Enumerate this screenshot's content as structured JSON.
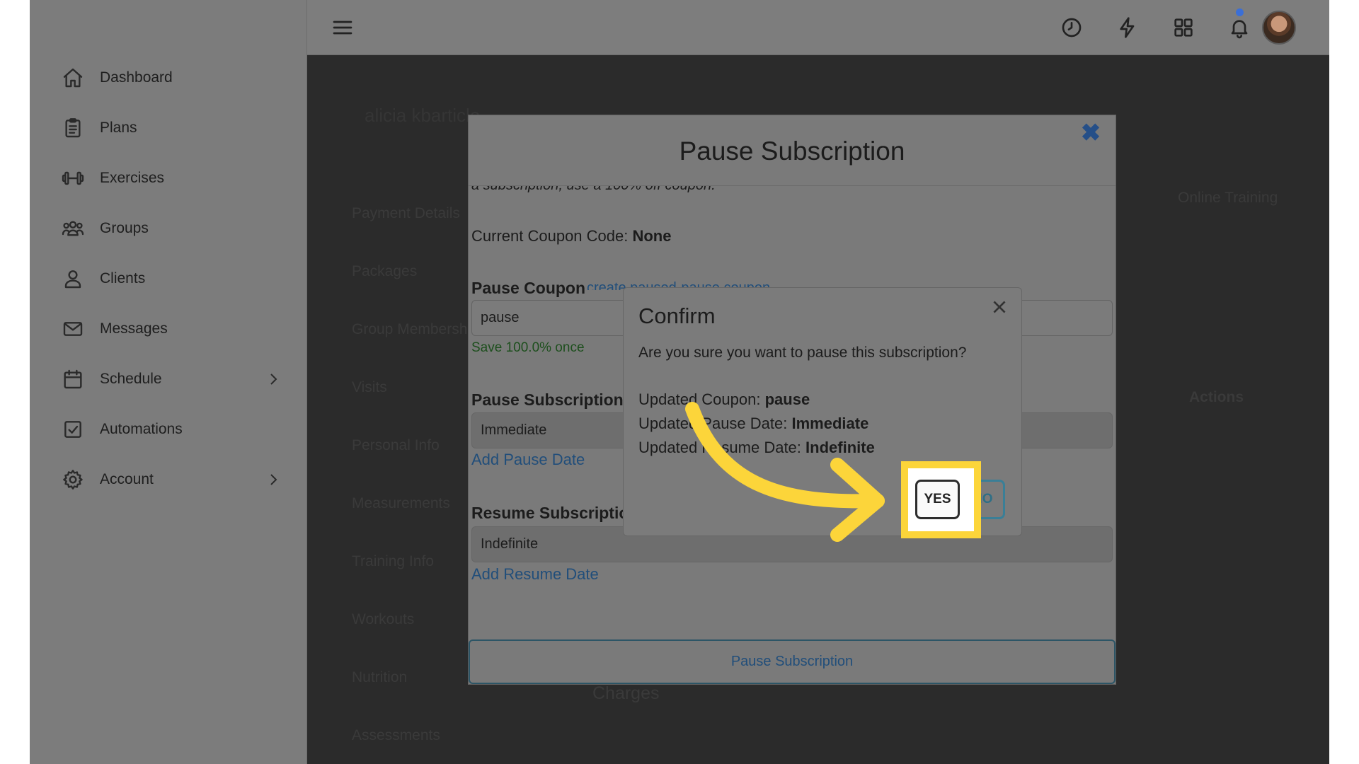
{
  "sidebar": {
    "items": [
      {
        "label": "Dashboard",
        "icon": "home-icon"
      },
      {
        "label": "Plans",
        "icon": "clipboard-icon"
      },
      {
        "label": "Exercises",
        "icon": "dumbbell-icon"
      },
      {
        "label": "Groups",
        "icon": "users-icon"
      },
      {
        "label": "Clients",
        "icon": "user-icon"
      },
      {
        "label": "Messages",
        "icon": "envelope-icon"
      },
      {
        "label": "Schedule",
        "icon": "calendar-icon",
        "has_submenu": true
      },
      {
        "label": "Automations",
        "icon": "checkbox-icon"
      },
      {
        "label": "Account",
        "icon": "gear-icon",
        "has_submenu": true
      }
    ]
  },
  "topbar": {
    "icons": [
      "menu-icon",
      "clock-icon",
      "lightning-icon",
      "grid-icon",
      "bell-icon",
      "avatar"
    ],
    "has_notification": true
  },
  "background": {
    "client_name": "alicia kbarticle",
    "tabs": [
      "Payment Details",
      "Packages",
      "Group Memberships",
      "Visits",
      "Personal Info",
      "Measurements",
      "Training Info",
      "Workouts",
      "Nutrition",
      "Assessments"
    ],
    "right_label": "Online Training",
    "actions_header": "Actions",
    "charges_header": "Charges"
  },
  "modal": {
    "title": "Pause Subscription",
    "intro_cut": "a subscription, use a 100% off coupon.",
    "current_coupon_label": "Current Coupon Code:",
    "current_coupon_value": "None",
    "pause_coupon_label": "Pause Coupon",
    "pause_coupon_link": "create paused-pause coupon",
    "pause_coupon_value": "pause",
    "save_note": "Save 100.0% once",
    "pause_sub_label": "Pause Subscription Date",
    "pause_date_value": "Immediate",
    "add_pause_date": "Add Pause Date",
    "resume_sub_label": "Resume Subscription Date",
    "resume_date_value": "Indefinite",
    "add_resume_date": "Add Resume Date",
    "submit_label": "Pause Subscription"
  },
  "confirm": {
    "title": "Confirm",
    "question": "Are you sure you want to pause this subscription?",
    "lines": [
      {
        "label": "Updated Coupon:",
        "value": "pause"
      },
      {
        "label": "Updated Pause Date:",
        "value": "Immediate"
      },
      {
        "label": "Updated Resume Date:",
        "value": "Indefinite"
      }
    ],
    "yes_label": "YES",
    "no_label": "NO"
  },
  "colors": {
    "highlight": "#fcd53a",
    "link": "#214e7a",
    "accent_teal": "#3a7f97"
  }
}
